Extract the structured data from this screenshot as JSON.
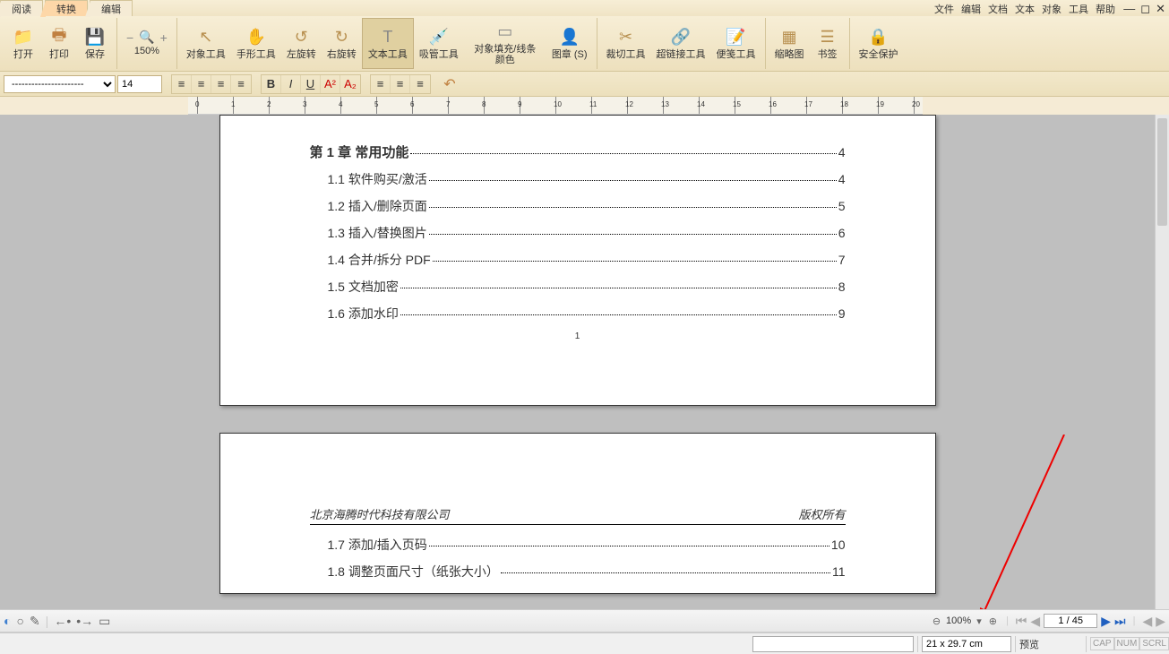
{
  "tabs": {
    "read": "阅读",
    "convert": "转换",
    "edit": "编辑"
  },
  "menus": {
    "file": "文件",
    "edit": "编辑",
    "doc": "文档",
    "text": "文本",
    "object": "对象",
    "tools": "工具",
    "help": "帮助"
  },
  "win": {
    "min": "—",
    "max": "◻",
    "close": "✕"
  },
  "toolbar": {
    "open": "打开",
    "print": "打印",
    "save": "保存",
    "zoom": "150%",
    "objtool": "对象工具",
    "handtool": "手形工具",
    "rotl": "左旋转",
    "rotr": "右旋转",
    "texttool": "文本工具",
    "pipette": "吸管工具",
    "fill": "对象填充/线条颜色",
    "stamp": "图章 (S)",
    "crop": "裁切工具",
    "link": "超链接工具",
    "note": "便笺工具",
    "thumb": "缩略图",
    "bookmark": "书签",
    "security": "安全保护"
  },
  "fmt": {
    "fontsize": "14"
  },
  "toc": {
    "title": "第 1 章  常用功能",
    "titlepg": "4",
    "items": [
      {
        "t": "1.1 软件购买/激活",
        "p": "4",
        "indent": 1
      },
      {
        "t": "1.2 插入/删除页面",
        "p": "5",
        "indent": 1
      },
      {
        "t": "1.3 插入/替换图片",
        "p": "6",
        "indent": 1
      },
      {
        "t": "1.4 合并/拆分 PDF",
        "p": "7",
        "indent": 1
      },
      {
        "t": "1.5 文档加密",
        "p": "8",
        "indent": 1
      },
      {
        "t": "1.6 添加水印",
        "p": "9",
        "indent": 1
      }
    ],
    "pgnum": "1",
    "footer_l": "北京海腾时代科技有限公司",
    "footer_r": "版权所有",
    "items2": [
      {
        "t": "1.7 添加/插入页码",
        "p": "10",
        "indent": 1
      },
      {
        "t": "1.8 调整页面尺寸（纸张大小）",
        "p": "11",
        "indent": 1
      }
    ]
  },
  "bottom": {
    "zoom": "100%",
    "page": "1 / 45",
    "dim": "21 x 29.7 cm",
    "preview": "预览"
  },
  "status": {
    "cap": "CAP",
    "num": "NUM",
    "scrl": "SCRL"
  }
}
